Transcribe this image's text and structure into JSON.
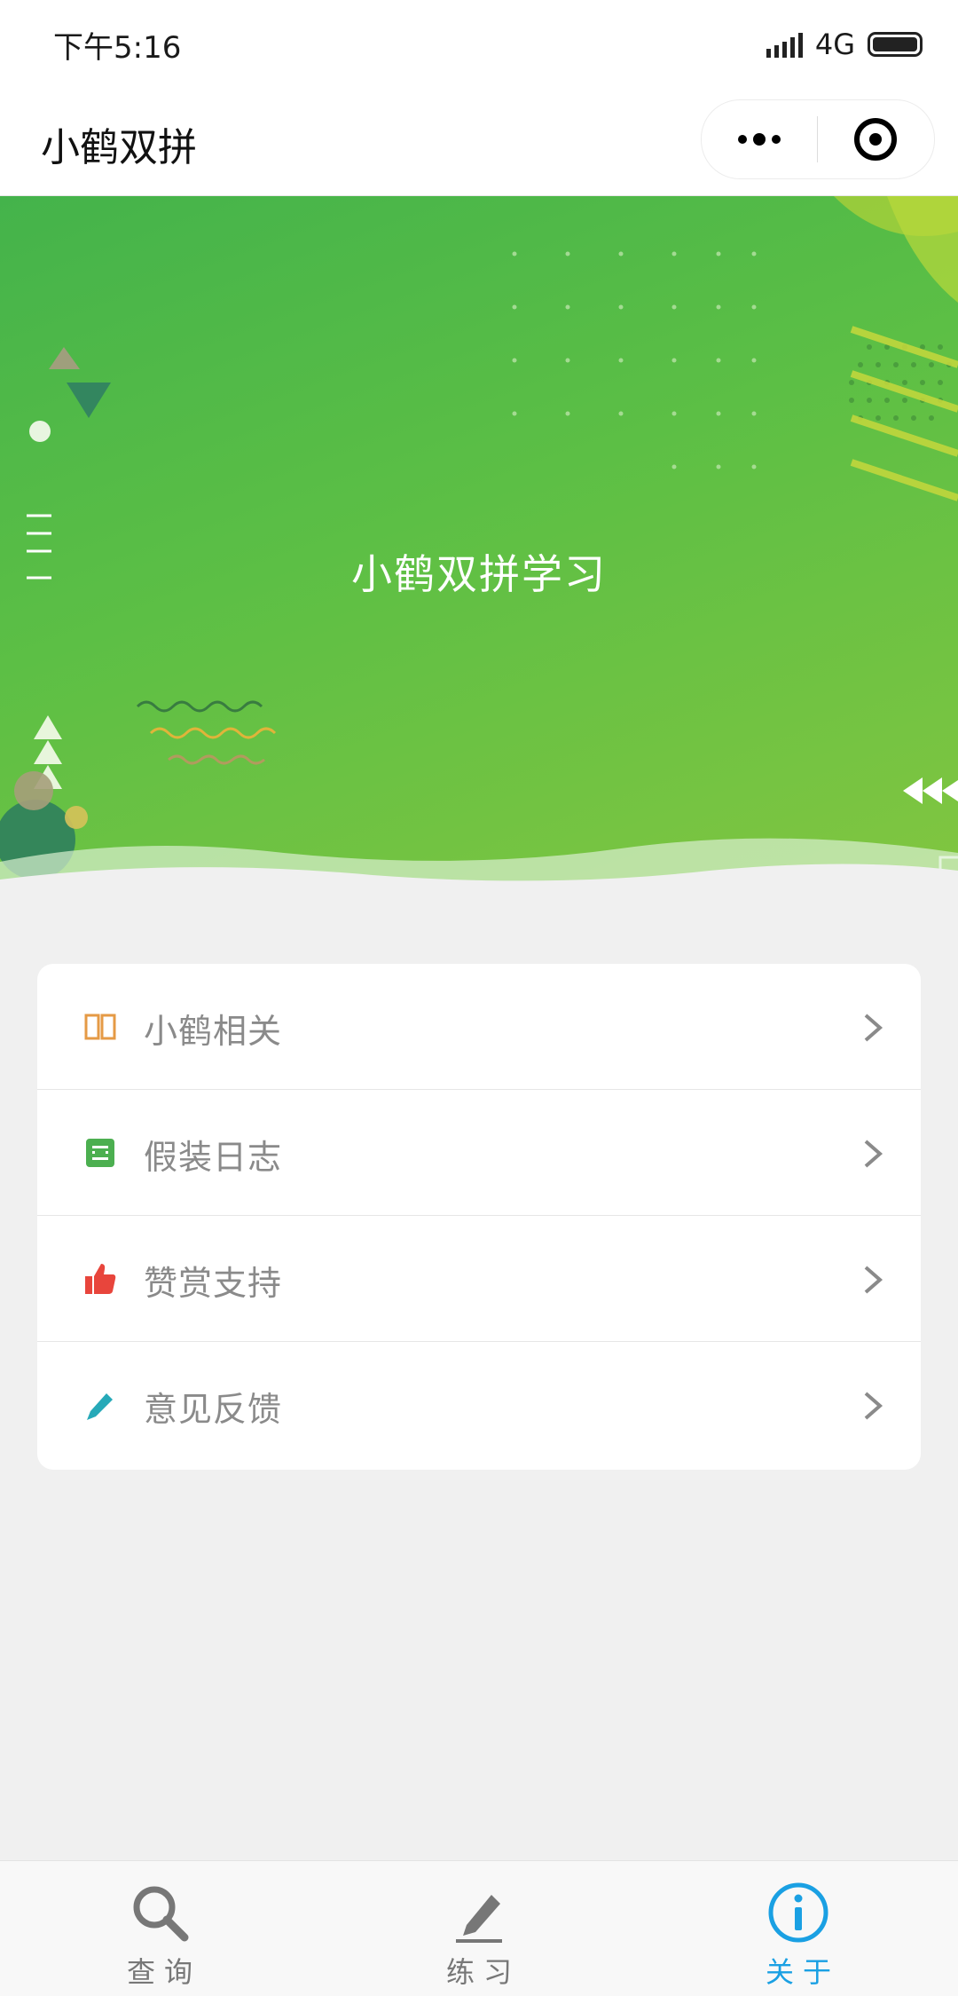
{
  "status_bar": {
    "time": "下午5:16",
    "network": "4G",
    "signal_level": 5,
    "battery_level": 1.0
  },
  "title_bar": {
    "title": "小鹤双拼",
    "more_icon": "more-dots-icon",
    "close_icon": "target-icon"
  },
  "banner": {
    "title": "小鹤双拼学习"
  },
  "menu": {
    "items": [
      {
        "label": "小鹤相关",
        "icon": "book-icon",
        "color": "#e59a45"
      },
      {
        "label": "假装日志",
        "icon": "note-icon",
        "color": "#4caf50"
      },
      {
        "label": "赞赏支持",
        "icon": "thumb-up-icon",
        "color": "#e8453c"
      },
      {
        "label": "意见反馈",
        "icon": "pencil-icon",
        "color": "#26a9b8"
      }
    ]
  },
  "tab_bar": {
    "tabs": [
      {
        "label": "查询",
        "icon": "search-icon",
        "active": false
      },
      {
        "label": "练习",
        "icon": "pencil-icon",
        "active": false
      },
      {
        "label": "关于",
        "icon": "info-icon",
        "active": true
      }
    ],
    "active_color": "#1aa0e3",
    "inactive_color": "#777777"
  }
}
